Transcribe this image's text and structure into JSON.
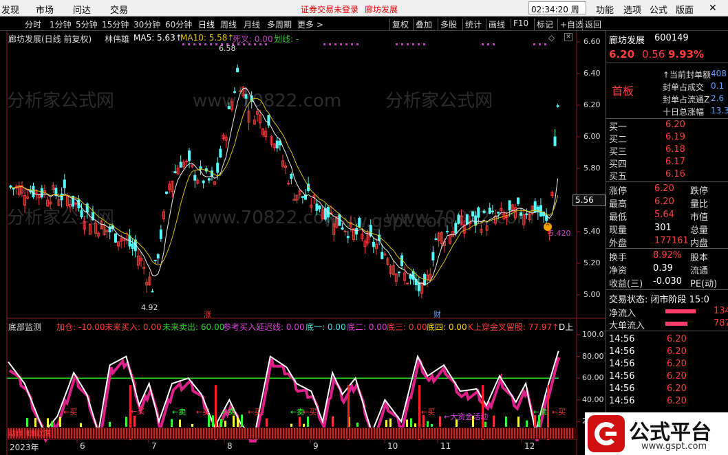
{
  "menu": [
    "发现",
    "市场",
    "问达",
    "交易"
  ],
  "warn": [
    "证券交易未登录",
    "廊坊发展"
  ],
  "clock": "02:34:20 周五",
  "menu_right": [
    "功能",
    "选项",
    "公式",
    "版面"
  ],
  "periods": [
    "分时",
    "1分钟",
    "5分钟",
    "15分钟",
    "30分钟",
    "60分钟",
    "日线",
    "周线",
    "月线",
    "多周期",
    "更多 >"
  ],
  "tools": [
    "复权",
    "叠加",
    "多股",
    "统计",
    "画线",
    "F10",
    "标记",
    "+自选",
    "返回"
  ],
  "upper": {
    "title": "廊坊发展(日线 前复权)",
    "name": "林伟雄",
    "ma5": "MA5: 5.63↑",
    "ma10": "MA10: 5.58↑",
    "dead": "死叉: 0.00",
    "line": "划线: -",
    "axis": [
      "6.60",
      "6.40",
      "6.20",
      "6.00",
      "5.80",
      "5.60",
      "5.40",
      "5.20",
      "5.00"
    ],
    "hi": "6.58",
    "lo": "4.92",
    "cur": "5.56",
    "mark_zhang": "涨",
    "mark_cai": "财",
    "mark_value": "5.420"
  },
  "lower": {
    "title": "底部监测",
    "items": [
      "加仓: -10.00",
      "未来买入: 0.00",
      "未来卖出: 60.00",
      "参考买入延迟线: 0.00",
      "底一: 0.00",
      "底二: 0.00",
      "底三: 0.00",
      "底四: 0.00",
      "K上穿金叉留股: 77.97↑",
      "D上"
    ],
    "axis": [
      "100.0",
      "80.00",
      "60.00",
      "40.00",
      "20.00"
    ],
    "notes": [
      "←买",
      "←买",
      "←卖",
      "←买",
      "←卖",
      "←买",
      "←卖",
      "←买",
      "←买",
      "←大资金活动",
      "←卖",
      "←买"
    ],
    "strip": "动作 ⅢⅢ以底"
  },
  "xaxis": [
    "2023年",
    "6",
    "7",
    "8",
    "9",
    "10",
    "11",
    "12"
  ],
  "watermarks": [
    "分析家公式网",
    "www.70822.com",
    "分析家公式网",
    "www.70822.com",
    "分析家公式网",
    "www.70822.com",
    "www.gspt.com"
  ],
  "quote": {
    "name": "廊坊发展",
    "code": "600149",
    "price": "6.20",
    "chg": "0.56",
    "pct": "9.93%",
    "board": "首板",
    "seal": [
      {
        "k": "↑当前封单额",
        "v": "408"
      },
      {
        "k": "封单占成交",
        "v": "0.1"
      },
      {
        "k": "封单占流通Z",
        "v": "2.6"
      },
      {
        "k": "十日总涨幅",
        "v": "13.3"
      }
    ],
    "bids": [
      {
        "k": "买一",
        "v": "6.20"
      },
      {
        "k": "买二",
        "v": "6.19"
      },
      {
        "k": "买三",
        "v": "6.18"
      },
      {
        "k": "买四",
        "v": "6.17"
      },
      {
        "k": "买五",
        "v": "6.16"
      }
    ],
    "stats": [
      {
        "k": "涨停",
        "v": "6.20",
        "k2": "跌停"
      },
      {
        "k": "最高",
        "v": "6.20",
        "k2": "量比"
      },
      {
        "k": "最低",
        "v": "5.64",
        "k2": "市值"
      },
      {
        "k": "现量",
        "v": "301",
        "k2": "总量"
      },
      {
        "k": "外盘",
        "v": "177161",
        "k2": "内盘"
      }
    ],
    "stats2": [
      {
        "k": "换手",
        "v": "8.92%",
        "k2": "股本"
      },
      {
        "k": "净资",
        "v": "0.39",
        "k2": "流通"
      },
      {
        "k": "收益(三)",
        "v": "-0.030",
        "k2": "PE(动)"
      }
    ],
    "state": "交易状态: 闭市阶段 15:0",
    "flows": [
      {
        "k": "净流入",
        "v": "134"
      },
      {
        "k": "大单流入",
        "v": "787"
      }
    ],
    "ticks": [
      {
        "t": "14:56",
        "p": "6.20"
      },
      {
        "t": "14:56",
        "p": "6.20"
      },
      {
        "t": "14:56",
        "p": "6.20"
      },
      {
        "t": "14:56",
        "p": "6.20"
      },
      {
        "t": "14:56",
        "p": "6.20"
      },
      {
        "t": "14:56",
        "p": "6.20"
      }
    ]
  },
  "logo": "公式平台",
  "logo_url": "www.gspt.com"
}
